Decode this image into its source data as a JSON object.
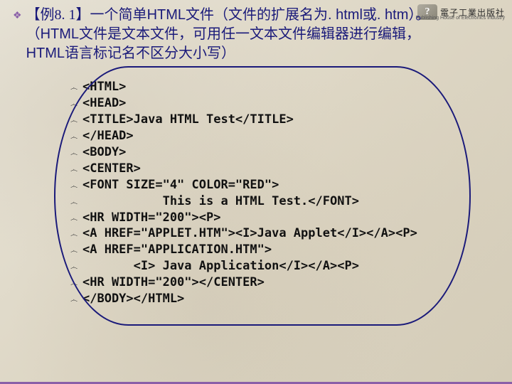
{
  "logo": {
    "mark": "?",
    "text": "電子工業出版社",
    "sub": "Publishing House of Electronics Industry"
  },
  "heading": {
    "bullet": "❖",
    "line1a": "【例8. 1】一个简单",
    "line1b": "HTML",
    "line1c": "文件（文件的扩展名为",
    "line1d": ". html",
    "line1e": "或",
    "line1f": ". htm",
    "line1g": "）。",
    "line2a": "（",
    "line2b": "HTML",
    "line2c": "文件是文本文件，可用任一文本文件编辑器进行编辑，",
    "line3a": "HTML",
    "line3b": "语言标记名不区分大小写）"
  },
  "code": [
    "<HTML>",
    "<HEAD>",
    "<TITLE>Java HTML Test</TITLE>",
    "</HEAD>",
    "<BODY>",
    "<CENTER>",
    "<FONT SIZE=\"4\" COLOR=\"RED\">",
    "           This is a HTML Test.</FONT>",
    "<HR WIDTH=\"200\"><P>",
    "<A HREF=\"APPLET.HTM\"><I>Java Applet</I></A><P>",
    "<A HREF=\"APPLICATION.HTM\">",
    "       <I> Java Application</I></A><P>",
    "<HR WIDTH=\"200\"></CENTER>",
    "</BODY></HTML>"
  ],
  "swirl": "෴"
}
